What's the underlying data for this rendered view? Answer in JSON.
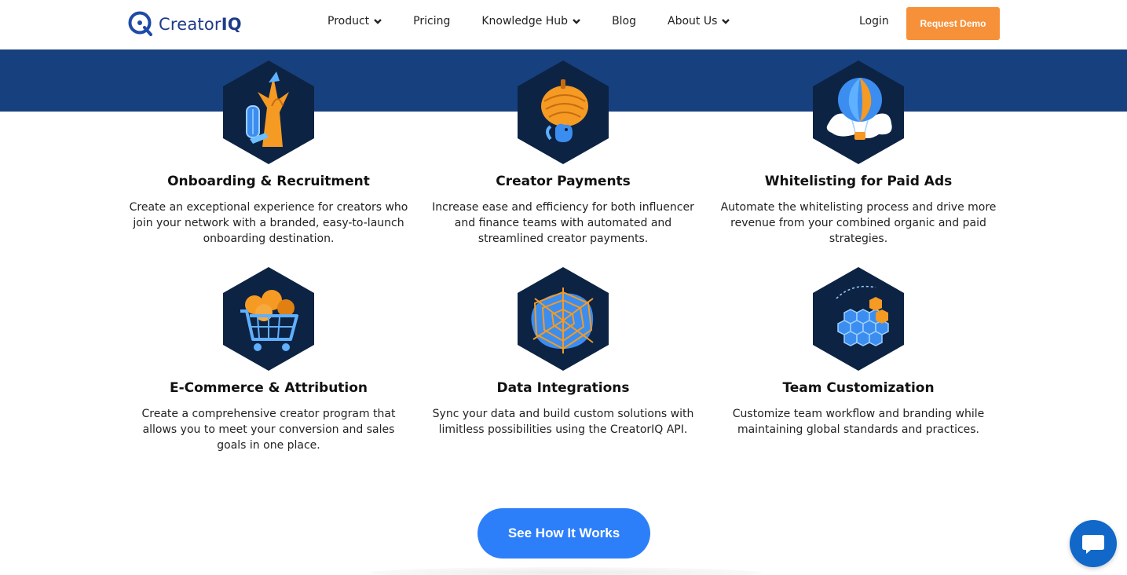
{
  "header": {
    "logo": {
      "word_plain": "Creator",
      "word_bold": "IQ"
    },
    "nav": [
      {
        "label": "Product",
        "has_dropdown": true
      },
      {
        "label": "Pricing",
        "has_dropdown": false
      },
      {
        "label": "Knowledge Hub",
        "has_dropdown": true
      },
      {
        "label": "Blog",
        "has_dropdown": false
      },
      {
        "label": "About Us",
        "has_dropdown": true
      }
    ],
    "login_label": "Login",
    "demo_label": "Request Demo"
  },
  "features": [
    {
      "icon": "tree-door-icon",
      "title": "Onboarding & Recruitment",
      "description": "Create an exceptional experience for creators who join your network with a branded, easy-to-launch onboarding destination."
    },
    {
      "icon": "squirrel-acorn-icon",
      "title": "Creator Payments",
      "description": "Increase ease and efficiency for both influencer and finance teams with automated and streamlined creator payments."
    },
    {
      "icon": "hot-air-balloon-icon",
      "title": "Whitelisting for Paid Ads",
      "description": "Automate the whitelisting process and drive more revenue from your combined organic and paid strategies."
    },
    {
      "icon": "shopping-cart-icon",
      "title": "E-Commerce & Attribution",
      "description": "Create a comprehensive creator program that allows you to meet your conversion and sales goals in one place."
    },
    {
      "icon": "spider-web-icon",
      "title": "Data Integrations",
      "description": "Sync your data and build custom solutions with limitless possibilities using the CreatorIQ API."
    },
    {
      "icon": "honeycomb-icon",
      "title": "Team Customization",
      "description": "Customize team workflow and branding while maintaining global standards and practices."
    }
  ],
  "cta": {
    "label": "See How It Works"
  },
  "chat": {
    "icon": "chat-bubble-icon"
  },
  "colors": {
    "brand_blue": "#17407f",
    "accent_orange": "#f6913a",
    "cta_blue": "#2d7ff9",
    "hex_navy": "#0d2344"
  }
}
